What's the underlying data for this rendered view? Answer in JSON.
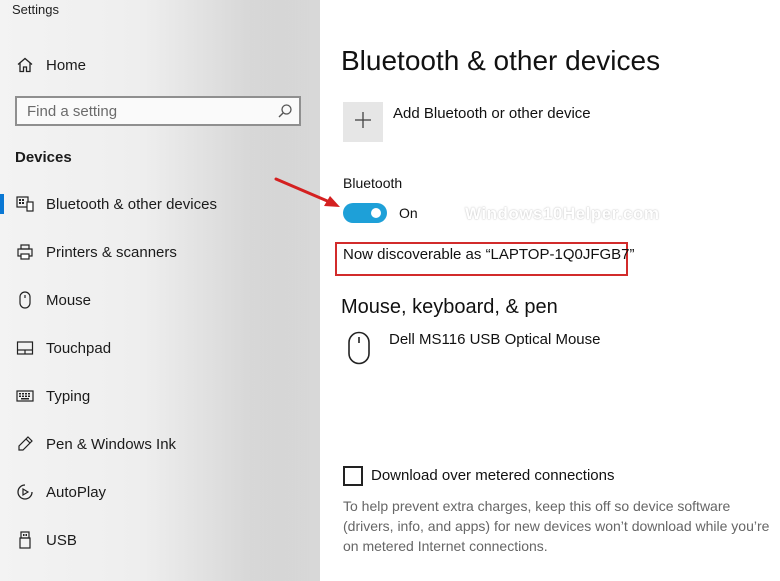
{
  "window": {
    "title": "Settings"
  },
  "sidebar": {
    "home_label": "Home",
    "search": {
      "placeholder": "Find a setting",
      "icon": "search-icon"
    },
    "section_title": "Devices",
    "items": [
      {
        "label": "Bluetooth & other devices",
        "icon": "bluetooth-devices-icon",
        "selected": true
      },
      {
        "label": "Printers & scanners",
        "icon": "printer-icon",
        "selected": false
      },
      {
        "label": "Mouse",
        "icon": "mouse-icon",
        "selected": false
      },
      {
        "label": "Touchpad",
        "icon": "touchpad-icon",
        "selected": false
      },
      {
        "label": "Typing",
        "icon": "keyboard-icon",
        "selected": false
      },
      {
        "label": "Pen & Windows Ink",
        "icon": "pen-icon",
        "selected": false
      },
      {
        "label": "AutoPlay",
        "icon": "autoplay-icon",
        "selected": false
      },
      {
        "label": "USB",
        "icon": "usb-icon",
        "selected": false
      }
    ],
    "accent_color": "#0a78d4"
  },
  "main": {
    "title": "Bluetooth & other devices",
    "add_device_label": "Add Bluetooth or other device",
    "bluetooth": {
      "label": "Bluetooth",
      "state_label": "On",
      "enabled": true,
      "toggle_color": "#1ea0d8"
    },
    "discoverable_text": "Now discoverable as “LAPTOP-1Q0JFGB7”",
    "watermark": "Windows10Helper.com",
    "devices_section_title": "Mouse, keyboard, & pen",
    "devices": [
      {
        "name": "Dell MS116 USB Optical Mouse",
        "icon": "mouse-icon"
      }
    ],
    "metered": {
      "label": "Download over metered connections",
      "checked": false,
      "help": "To help prevent extra charges, keep this off so device software (drivers, info, and apps) for new devices won’t download while you’re on metered Internet connections."
    }
  },
  "annotations": {
    "highlight_color": "#d22b2b",
    "arrow_color": "#d42020"
  }
}
